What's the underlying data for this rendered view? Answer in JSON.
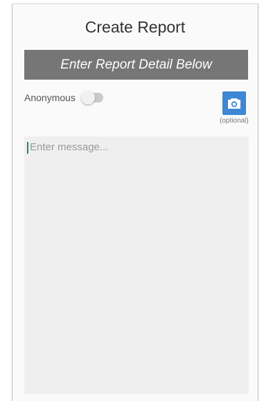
{
  "header": {
    "title": "Create Report"
  },
  "banner": {
    "text": "Enter Report Detail Below"
  },
  "anonymous": {
    "label": "Anonymous",
    "enabled": false
  },
  "camera": {
    "icon": "camera-icon",
    "caption": "(optional)"
  },
  "message": {
    "placeholder": "Enter message...",
    "value": ""
  },
  "colors": {
    "banner": "#767676",
    "camera_button": "#3d87d4",
    "cursor": "#1a8a7a"
  }
}
